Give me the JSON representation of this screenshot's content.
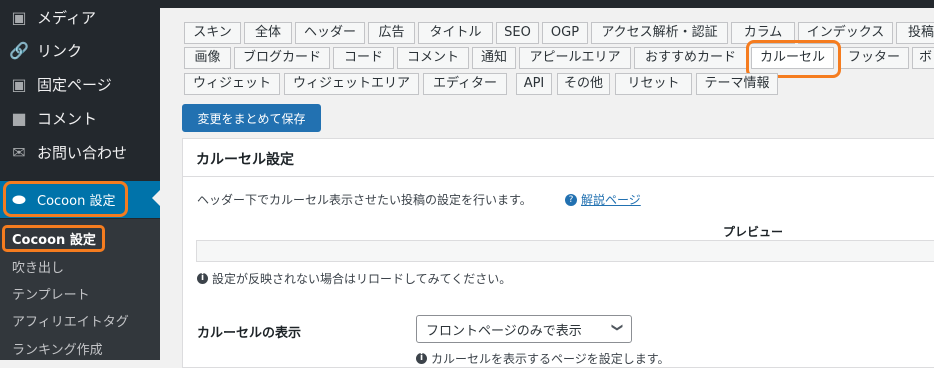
{
  "sidebar": {
    "menu": [
      {
        "label": "メディア",
        "icon": "media-icon"
      },
      {
        "label": "リンク",
        "icon": "link-icon"
      },
      {
        "label": "固定ページ",
        "icon": "page-icon"
      },
      {
        "label": "コメント",
        "icon": "comment-icon"
      },
      {
        "label": "お問い合わせ",
        "icon": "mail-icon"
      },
      {
        "label": "Cocoon 設定",
        "icon": "cocoon-icon"
      }
    ],
    "submenu": [
      "Cocoon 設定",
      "吹き出し",
      "テンプレート",
      "アフィリエイトタグ",
      "ランキング作成"
    ]
  },
  "tabs": {
    "row1": [
      "スキン",
      "全体",
      "ヘッダー",
      "広告",
      "タイトル",
      "SEO",
      "OGP",
      "アクセス解析・認証",
      "カラム",
      "インデックス",
      "投稿"
    ],
    "row2": [
      "画像",
      "ブログカード",
      "コード",
      "コメント",
      "通知",
      "アピールエリア",
      "おすすめカード",
      "カルーセル",
      "フッター",
      "ボ"
    ],
    "row3": [
      "ウィジェット",
      "ウィジェットエリア",
      "エディター",
      "API",
      "その他",
      "リセット",
      "テーマ情報"
    ],
    "active": "カルーセル"
  },
  "save_button": "変更をまとめて保存",
  "panel": {
    "title": "カルーセル設定",
    "description": "ヘッダー下でカルーセル表示させたい投稿の設定を行います。",
    "help_link": "解説ページ",
    "preview_label": "プレビュー",
    "reload_note": "設定が反映されない場合はリロードしてみてください。",
    "display_label": "カルーセルの表示",
    "display_value": "フロントページのみで表示",
    "display_note": "カルーセルを表示するページを設定します。"
  },
  "colors": {
    "highlight": "#f57c1f",
    "wp_blue": "#0073aa",
    "sidebar_bg": "#23282d"
  }
}
